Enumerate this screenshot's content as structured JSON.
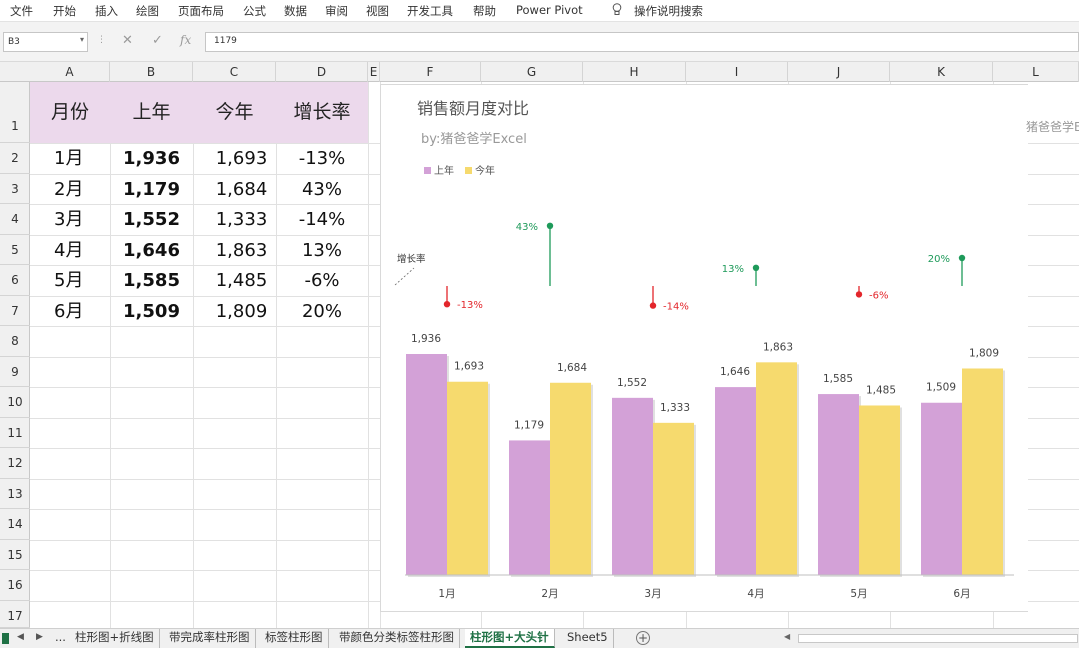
{
  "menu": [
    "文件",
    "开始",
    "插入",
    "绘图",
    "页面布局",
    "公式",
    "数据",
    "审阅",
    "视图",
    "开发工具",
    "帮助",
    "Power Pivot",
    "操作说明搜索"
  ],
  "formula_bar": {
    "name_box": "B3",
    "formula": "1179",
    "fx_label": "fx"
  },
  "columns": [
    "A",
    "B",
    "C",
    "D",
    "E",
    "F",
    "G",
    "H",
    "I",
    "J",
    "K",
    "L"
  ],
  "rows": [
    "1",
    "2",
    "3",
    "4",
    "5",
    "6",
    "7",
    "8",
    "9",
    "10",
    "11",
    "12",
    "13",
    "14",
    "15",
    "16",
    "17"
  ],
  "table": {
    "headers": [
      "月份",
      "上年",
      "今年",
      "增长率"
    ],
    "rows": [
      [
        "1月",
        "1,936",
        "1,693",
        "-13%"
      ],
      [
        "2月",
        "1,179",
        "1,684",
        "43%"
      ],
      [
        "3月",
        "1,552",
        "1,333",
        "-14%"
      ],
      [
        "4月",
        "1,646",
        "1,863",
        "13%"
      ],
      [
        "5月",
        "1,585",
        "1,485",
        "-6%"
      ],
      [
        "6月",
        "1,509",
        "1,809",
        "20%"
      ]
    ]
  },
  "colors": {
    "last_year": "#d3a1d7",
    "this_year": "#f6da6e",
    "growth_up": "#1e9a5a",
    "growth_down": "#e3262b",
    "header_fill": "#ecd9ec"
  },
  "chart_data": {
    "type": "bar",
    "title": "销售额月度对比",
    "subtitle": "by:猪爸爸学Excel",
    "growth_axis_label": "增长率",
    "categories": [
      "1月",
      "2月",
      "3月",
      "4月",
      "5月",
      "6月"
    ],
    "series": [
      {
        "name": "上年",
        "values": [
          1936,
          1179,
          1552,
          1646,
          1585,
          1509
        ],
        "labels": [
          "1,936",
          "1,179",
          "1,552",
          "1,646",
          "1,585",
          "1,509"
        ]
      },
      {
        "name": "今年",
        "values": [
          1693,
          1684,
          1333,
          1863,
          1485,
          1809
        ],
        "labels": [
          "1,693",
          "1,684",
          "1,333",
          "1,863",
          "1,485",
          "1,809"
        ]
      }
    ],
    "growth": {
      "values": [
        -13,
        43,
        -14,
        13,
        -6,
        20
      ],
      "labels": [
        "-13%",
        "43%",
        "-14%",
        "13%",
        "-6%",
        "20%"
      ]
    },
    "ylim": [
      0,
      2200
    ],
    "grid": false,
    "legend": "top-left"
  },
  "ghost_text": "猪爸爸学Ex",
  "sheet_tabs": {
    "ellipsis": "...",
    "tabs": [
      "柱形图+折线图",
      "带完成率柱形图",
      "标签柱形图",
      "带颜色分类标签柱形图",
      "柱形图+大头针",
      "Sheet5"
    ],
    "active_index": 4,
    "add_label": "+"
  }
}
